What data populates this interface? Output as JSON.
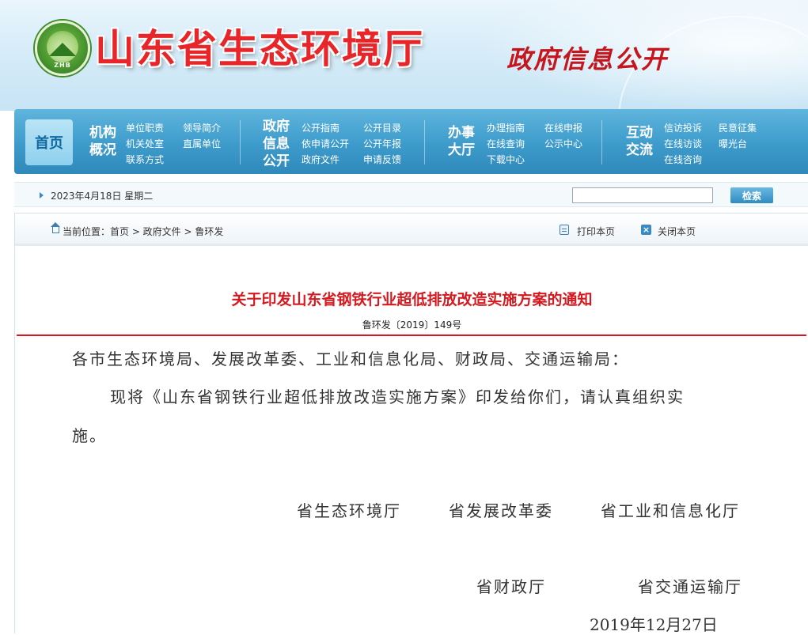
{
  "site": {
    "title": "山东省生态环境厅",
    "logo_text": "ZHB",
    "subtitle": "政府信息公开"
  },
  "nav": {
    "home": "首页",
    "groups": [
      {
        "title_lines": [
          "机构",
          "概况"
        ],
        "links": [
          "单位职责",
          "领导简介",
          "机关处室",
          "直属单位",
          "联系方式"
        ]
      },
      {
        "title_lines": [
          "政府",
          "信息",
          "公开"
        ],
        "links": [
          "公开指南",
          "公开目录",
          "依申请公开",
          "公开年报",
          "政府文件",
          "申请反馈"
        ]
      },
      {
        "title_lines": [
          "办事",
          "大厅"
        ],
        "links": [
          "办理指南",
          "在线申报",
          "在线查询",
          "公示中心",
          "下载中心"
        ]
      },
      {
        "title_lines": [
          "互动",
          "交流"
        ],
        "links": [
          "信访投诉",
          "民意征集",
          "在线访谈",
          "曝光台",
          "在线咨询"
        ]
      }
    ]
  },
  "datebar": {
    "date": "2023年4月18日 星期二",
    "search_value": "",
    "search_button": "检索"
  },
  "breadcrumb": {
    "text": "当前位置：首页 > 政府文件 > 鲁环发",
    "print": "打印本页",
    "close": "关闭本页"
  },
  "document": {
    "title": "关于印发山东省钢铁行业超低排放改造实施方案的通知",
    "number": "鲁环发〔2019〕149号",
    "recipients": "各市生态环境局、发展改革委、工业和信息化局、财政局、交通运输局：",
    "body_line1": "现将《山东省钢铁行业超低排放改造实施方案》印发给你们，请认真组织实",
    "body_line2": "施。",
    "signatories_row1": [
      "省生态环境厅",
      "省发展改革委",
      "省工业和信息化厅"
    ],
    "signatories_row2": [
      "省财政厅",
      "省交通运输厅"
    ],
    "date": "2019年12月27日"
  },
  "colors": {
    "title_red": "#d7191f",
    "nav_blue": "#3d9bcb",
    "banner_red": "#e8262a"
  }
}
